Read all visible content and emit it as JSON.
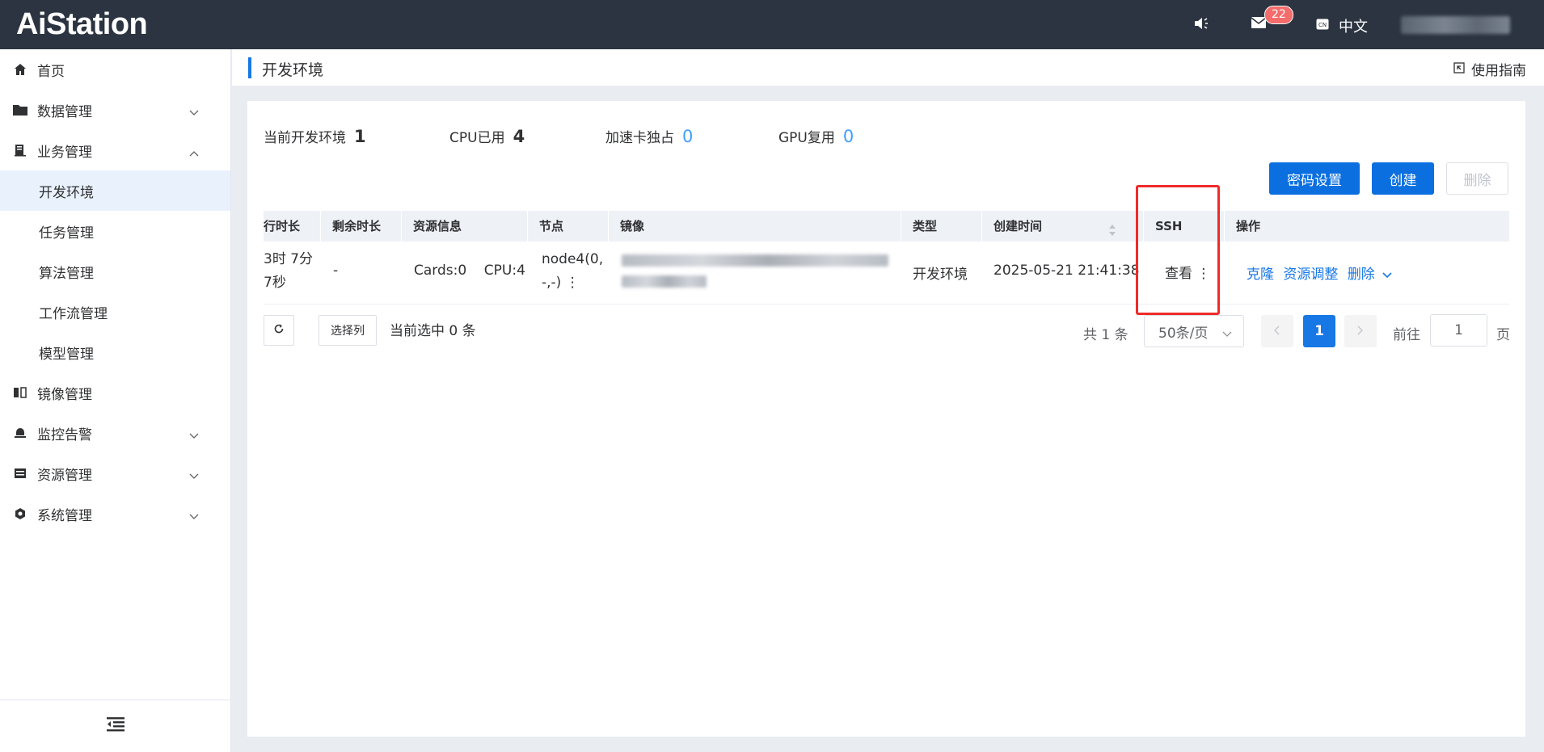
{
  "app": {
    "logo": "AiStation"
  },
  "header": {
    "mail_count": "22",
    "lang_label": "中文"
  },
  "sidebar": {
    "items": [
      {
        "label": "首页",
        "icon": "home-icon"
      },
      {
        "label": "数据管理",
        "icon": "folder-icon",
        "expand": "collapsed"
      },
      {
        "label": "业务管理",
        "icon": "business-icon",
        "expand": "expanded"
      },
      {
        "label": "开发环境",
        "sub": true,
        "active": true
      },
      {
        "label": "任务管理",
        "sub": true
      },
      {
        "label": "算法管理",
        "sub": true
      },
      {
        "label": "工作流管理",
        "sub": true
      },
      {
        "label": "模型管理",
        "sub": true
      },
      {
        "label": "镜像管理",
        "icon": "image-icon"
      },
      {
        "label": "监控告警",
        "icon": "alarm-icon",
        "expand": "collapsed"
      },
      {
        "label": "资源管理",
        "icon": "resource-icon",
        "expand": "collapsed"
      },
      {
        "label": "系统管理",
        "icon": "system-icon",
        "expand": "collapsed"
      }
    ]
  },
  "page": {
    "title": "开发环境",
    "guide_label": "使用指南"
  },
  "stats": {
    "dev_env_label": "当前开发环境",
    "dev_env_value": "1",
    "cpu_label": "CPU已用",
    "cpu_value": "4",
    "card_label": "加速卡独占",
    "card_value": "0",
    "gpu_label": "GPU复用",
    "gpu_value": "0"
  },
  "toolbar": {
    "password_label": "密码设置",
    "create_label": "创建",
    "delete_label": "删除"
  },
  "table": {
    "headers": {
      "runtime": "行时长",
      "remaining": "剩余时长",
      "resource": "资源信息",
      "node": "节点",
      "image": "镜像",
      "type": "类型",
      "created": "创建时间",
      "ssh": "SSH",
      "ops": "操作"
    },
    "row": {
      "runtime_line1": "3时 7分",
      "runtime_line2": "7秒",
      "remaining": "-",
      "resource": "Cards:0    CPU:4",
      "node_line1": "node4(0,",
      "node_line2": "-,-) ⋮",
      "type": "开发环境",
      "created": "2025-05-21 21:41:38",
      "ssh": "查看 ⋮",
      "op_clone": "克隆",
      "op_adjust": "资源调整",
      "op_delete": "删除"
    }
  },
  "footer": {
    "column_select": "选择列",
    "selected_text": "当前选中 0 条",
    "total": "共 1 条",
    "page_size": "50条/页",
    "current_page": "1",
    "goto_label": "前往",
    "goto_value": "1",
    "page_unit": "页"
  }
}
